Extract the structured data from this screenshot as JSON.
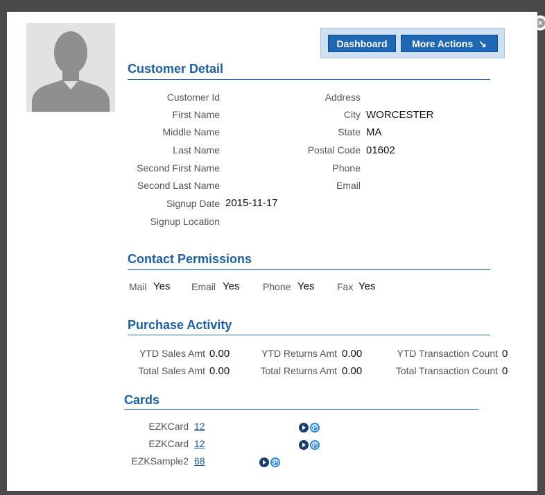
{
  "close": {
    "icon": "close-icon"
  },
  "avatar": {
    "icon": "person-silhouette-icon"
  },
  "actions": {
    "dashboard": "Dashboard",
    "more_actions": "More Actions",
    "more_icon": "↘"
  },
  "customer_detail": {
    "title": "Customer Detail",
    "left": [
      {
        "label": "Customer Id",
        "value": ""
      },
      {
        "label": "First Name",
        "value": ""
      },
      {
        "label": "Middle Name",
        "value": ""
      },
      {
        "label": "Last Name",
        "value": ""
      },
      {
        "label": "Second First Name",
        "value": ""
      },
      {
        "label": "Second Last Name",
        "value": ""
      },
      {
        "label": "Signup Date",
        "value": "2015-11-17"
      },
      {
        "label": "Signup Location",
        "value": ""
      }
    ],
    "right": [
      {
        "label": "Address",
        "value": ""
      },
      {
        "label": "City",
        "value": "WORCESTER"
      },
      {
        "label": "State",
        "value": "MA"
      },
      {
        "label": "Postal Code",
        "value": "01602"
      },
      {
        "label": "Phone",
        "value": ""
      },
      {
        "label": "Email",
        "value": ""
      }
    ]
  },
  "contact_permissions": {
    "title": "Contact Permissions",
    "items": [
      {
        "label": "Mail",
        "value": "Yes"
      },
      {
        "label": "Email",
        "value": "Yes"
      },
      {
        "label": "Phone",
        "value": "Yes"
      },
      {
        "label": "Fax",
        "value": "Yes"
      }
    ]
  },
  "purchase_activity": {
    "title": "Purchase Activity",
    "rows": [
      [
        {
          "label": "YTD Sales Amt",
          "value": "0.00"
        },
        {
          "label": "YTD Returns Amt",
          "value": "0.00"
        },
        {
          "label": "YTD Transaction Count",
          "value": "0"
        }
      ],
      [
        {
          "label": "Total Sales Amt",
          "value": "0.00"
        },
        {
          "label": "Total Returns Amt",
          "value": "0.00"
        },
        {
          "label": "Total Transaction Count",
          "value": "0"
        }
      ]
    ]
  },
  "cards": {
    "title": "Cards",
    "items": [
      {
        "type": "EZKCard",
        "number": "12"
      },
      {
        "type": "EZKCard",
        "number": "12"
      },
      {
        "type": "EZKSample2",
        "number": "68"
      }
    ],
    "arrow_icon": "arrow-right-circle-icon",
    "points_icon": "points-icon",
    "points_glyph": "P"
  },
  "colors": {
    "overlay": "#4a4a4a",
    "accent": "#1d5fa3",
    "button": "#1d67b4"
  }
}
